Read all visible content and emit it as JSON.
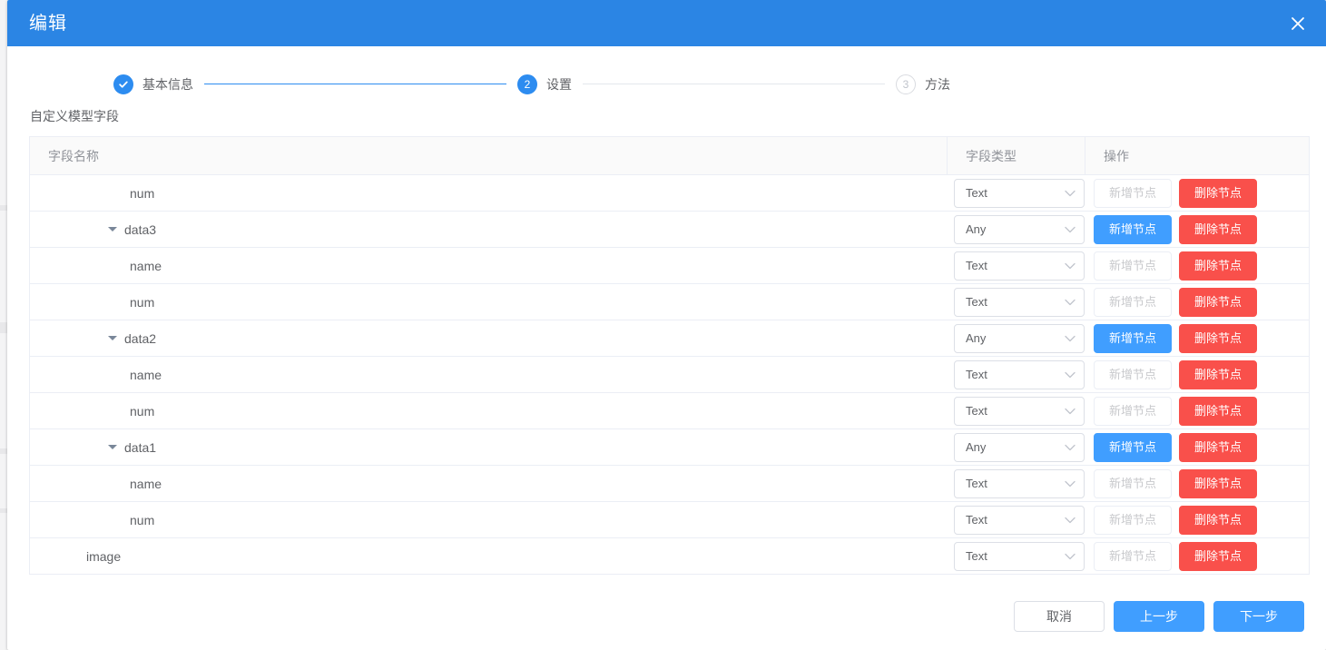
{
  "modal": {
    "title": "编辑",
    "close_icon": "close-icon"
  },
  "steps": [
    {
      "index": "1",
      "label": "基本信息",
      "state": "done",
      "icon": "check-icon"
    },
    {
      "index": "2",
      "label": "设置",
      "state": "active",
      "icon": "number"
    },
    {
      "index": "3",
      "label": "方法",
      "state": "wait",
      "icon": "number"
    }
  ],
  "section": {
    "label": "自定义模型字段"
  },
  "table": {
    "columns": [
      "字段名称",
      "字段类型",
      "操作"
    ],
    "buttons": {
      "add_node": "新增节点",
      "delete_node": "删除节点"
    },
    "rows": [
      {
        "name": "num",
        "level": 2,
        "expandable": false,
        "type": "Text",
        "add_enabled": false
      },
      {
        "name": "data3",
        "level": 1,
        "expandable": true,
        "type": "Any",
        "add_enabled": true
      },
      {
        "name": "name",
        "level": 2,
        "expandable": false,
        "type": "Text",
        "add_enabled": false
      },
      {
        "name": "num",
        "level": 2,
        "expandable": false,
        "type": "Text",
        "add_enabled": false
      },
      {
        "name": "data2",
        "level": 1,
        "expandable": true,
        "type": "Any",
        "add_enabled": true
      },
      {
        "name": "name",
        "level": 2,
        "expandable": false,
        "type": "Text",
        "add_enabled": false
      },
      {
        "name": "num",
        "level": 2,
        "expandable": false,
        "type": "Text",
        "add_enabled": false
      },
      {
        "name": "data1",
        "level": 1,
        "expandable": true,
        "type": "Any",
        "add_enabled": true
      },
      {
        "name": "name",
        "level": 2,
        "expandable": false,
        "type": "Text",
        "add_enabled": false
      },
      {
        "name": "num",
        "level": 2,
        "expandable": false,
        "type": "Text",
        "add_enabled": false
      },
      {
        "name": "image",
        "level": 0,
        "expandable": false,
        "type": "Text",
        "add_enabled": false
      }
    ]
  },
  "footer": {
    "cancel": "取消",
    "previous": "上一步",
    "next": "下一步"
  },
  "colors": {
    "header_blue": "#2b85e4",
    "primary": "#409eff",
    "step_blue": "#2d8cf0",
    "danger": "#f9504b",
    "border": "#ebeef5",
    "text": "#606266",
    "muted": "#909399"
  }
}
